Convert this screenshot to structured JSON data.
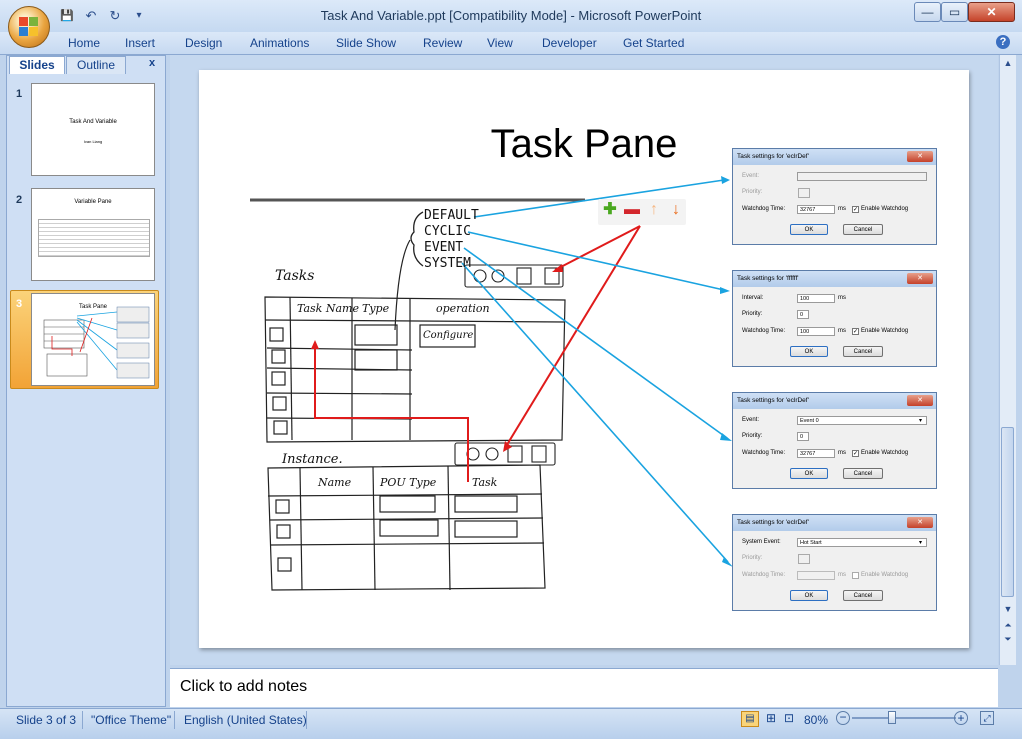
{
  "window": {
    "title": "Task And Variable.ppt [Compatibility Mode] - Microsoft PowerPoint",
    "minimize": "—",
    "maximize": "▭",
    "close": "✕"
  },
  "qat": {
    "save": "💾",
    "undo": "↶",
    "redo": "↻",
    "more": "▾"
  },
  "ribbon": {
    "tabs": [
      "Home",
      "Insert",
      "Design",
      "Animations",
      "Slide Show",
      "Review",
      "View",
      "Developer",
      "Get Started"
    ],
    "help": "?"
  },
  "left_pane": {
    "tabs": {
      "slides": "Slides",
      "outline": "Outline",
      "close": "x"
    },
    "thumbnails": [
      {
        "num": "1",
        "title": "Task And Variable",
        "subtitle": "Ivan Liang"
      },
      {
        "num": "2",
        "title": "Variable Pane"
      },
      {
        "num": "3",
        "title": "Task Pane"
      }
    ]
  },
  "slide": {
    "title": "Task Pane",
    "toolbar_icons": [
      "plus-icon",
      "minus-icon",
      "arrow-up-icon",
      "arrow-down-icon"
    ],
    "sketch": {
      "task_types": [
        "DEFAULT",
        "CYCLIC",
        "EVENT",
        "SYSTEM"
      ],
      "tasks_label": "Tasks",
      "tasks_headers": [
        "Task Name",
        "Type",
        "operation"
      ],
      "configure_button": "Configure",
      "instance_label": "Instance.",
      "instance_headers": [
        "Name",
        "POU Type",
        "Task"
      ]
    },
    "dialogs": [
      {
        "title": "Task settings for 'eclrDef'",
        "rows": [
          {
            "label": "Event:",
            "value": "",
            "disabled": true,
            "kind": "select"
          },
          {
            "label": "Priority:",
            "value": "",
            "disabled": true,
            "kind": "check"
          },
          {
            "label": "Watchdog Time:",
            "value": "32767",
            "unit": "ms",
            "check_label": "Enable Watchdog",
            "checked": true
          }
        ],
        "ok": "OK",
        "cancel": "Cancel"
      },
      {
        "title": "Task settings for 'ffffff'",
        "rows": [
          {
            "label": "Interval:",
            "value": "100",
            "unit": "ms"
          },
          {
            "label": "Priority:",
            "value": "0"
          },
          {
            "label": "Watchdog Time:",
            "value": "100",
            "unit": "ms",
            "check_label": "Enable Watchdog",
            "checked": true
          }
        ],
        "ok": "OK",
        "cancel": "Cancel"
      },
      {
        "title": "Task settings for 'eclrDef'",
        "rows": [
          {
            "label": "Event:",
            "value": "Event 0",
            "kind": "select"
          },
          {
            "label": "Priority:",
            "value": "0"
          },
          {
            "label": "Watchdog Time:",
            "value": "32767",
            "unit": "ms",
            "check_label": "Enable Watchdog",
            "checked": true
          }
        ],
        "ok": "OK",
        "cancel": "Cancel"
      },
      {
        "title": "Task settings for 'eclrDef'",
        "rows": [
          {
            "label": "System Event:",
            "value": "Hot Start",
            "kind": "select"
          },
          {
            "label": "Priority:",
            "value": "",
            "disabled": true,
            "kind": "check"
          },
          {
            "label": "Watchdog Time:",
            "value": "",
            "unit": "ms",
            "check_label": "Enable Watchdog",
            "checked": false,
            "disabled": true
          }
        ],
        "ok": "OK",
        "cancel": "Cancel"
      }
    ]
  },
  "notes": {
    "placeholder": "Click to add notes"
  },
  "status": {
    "slide": "Slide 3 of 3",
    "theme": "\"Office Theme\"",
    "language": "English (United States)",
    "zoom": "80%",
    "zoom_level_percent": 80
  },
  "colors": {
    "accent_blue": "#1aa3e0",
    "accent_red": "#e01b1b",
    "selection": "#f2a336"
  }
}
